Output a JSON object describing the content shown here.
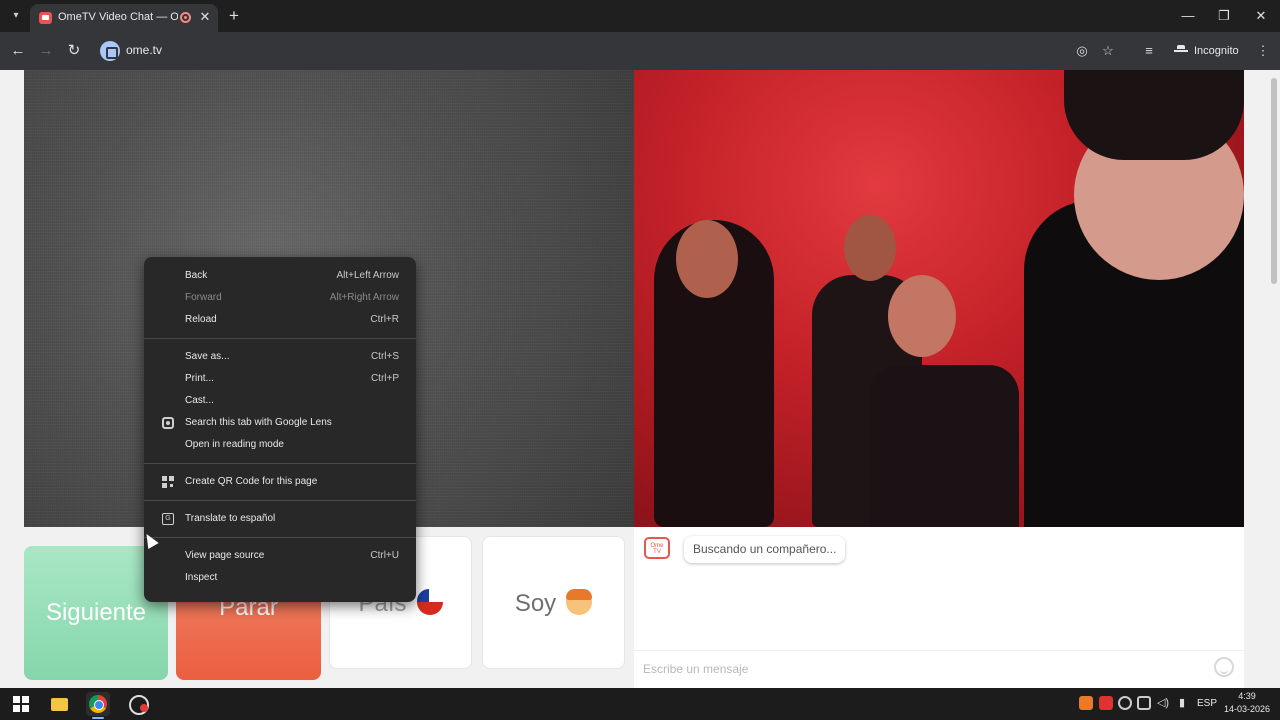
{
  "browser": {
    "tab_title": "OmeTV Video Chat — Ome",
    "tab_close": "✕",
    "new_tab": "+",
    "url": "ome.tv",
    "incognito_label": "Incognito",
    "window_controls": {
      "minimize": "—",
      "maximize": "❐",
      "close": "✕"
    },
    "nav": {
      "back": "←",
      "forward": "→",
      "reload": "↻"
    },
    "toolbar_icons": [
      "eye-off-icon",
      "star-icon",
      "tab-search-icon",
      "kebab-menu-icon"
    ]
  },
  "page": {
    "buttons": {
      "next": "Siguiente",
      "stop": "Parar",
      "country": "País",
      "soy": "Soy"
    },
    "chat": {
      "logo_text": "Ome TV",
      "status_message": "Buscando un compañero...",
      "input_placeholder": "Escribe un mensaje"
    }
  },
  "context_menu": {
    "groups": [
      [
        {
          "label": "Back",
          "shortcut": "Alt+Left Arrow",
          "disabled": false
        },
        {
          "label": "Forward",
          "shortcut": "Alt+Right Arrow",
          "disabled": true
        },
        {
          "label": "Reload",
          "shortcut": "Ctrl+R",
          "disabled": false
        }
      ],
      [
        {
          "label": "Save as...",
          "shortcut": "Ctrl+S",
          "disabled": false
        },
        {
          "label": "Print...",
          "shortcut": "Ctrl+P",
          "disabled": false
        },
        {
          "label": "Cast...",
          "shortcut": "",
          "disabled": false
        },
        {
          "label": "Search this tab with Google Lens",
          "shortcut": "",
          "icon": "lens-icon",
          "disabled": false
        },
        {
          "label": "Open in reading mode",
          "shortcut": "",
          "disabled": false
        }
      ],
      [
        {
          "label": "Create QR Code for this page",
          "shortcut": "",
          "icon": "qr-code-icon",
          "disabled": false
        }
      ],
      [
        {
          "label": "Translate to español",
          "shortcut": "",
          "icon": "translate-icon",
          "disabled": false
        }
      ],
      [
        {
          "label": "View page source",
          "shortcut": "Ctrl+U",
          "disabled": false
        },
        {
          "label": "Inspect",
          "shortcut": "",
          "disabled": false
        }
      ]
    ]
  },
  "taskbar": {
    "language": "ESP",
    "time": "4:39",
    "date": "14-03-2026"
  }
}
